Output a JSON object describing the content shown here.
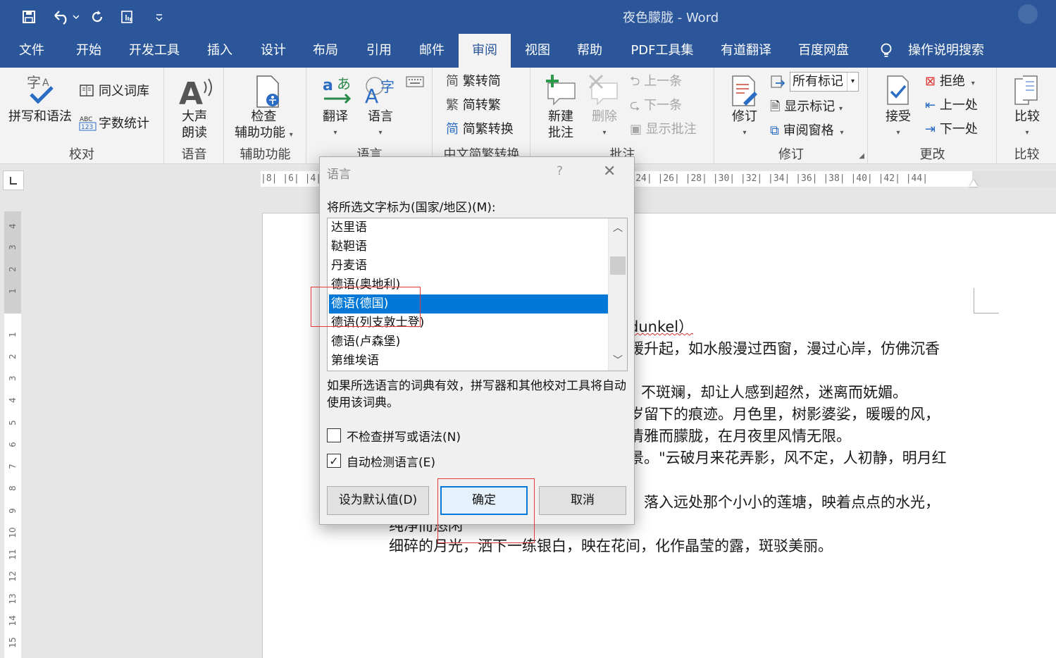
{
  "window": {
    "title": "夜色朦胧  -  Word"
  },
  "qat": {
    "save_icon": "save-icon",
    "undo_icon": "undo-icon",
    "redo_icon": "redo-icon",
    "touch_icon": "touch-mode-icon",
    "more_icon": "chevron-down-icon"
  },
  "tabs": [
    "文件",
    "开始",
    "开发工具",
    "插入",
    "设计",
    "布局",
    "引用",
    "邮件",
    "审阅",
    "视图",
    "帮助",
    "PDF工具集",
    "有道翻译",
    "百度网盘",
    "操作说明搜索"
  ],
  "active_tab": "审阅",
  "ribbon": {
    "proofing": {
      "label": "校对",
      "spelling": "拼写和语法",
      "thesaurus": "同义词库",
      "wordcount": "字数统计"
    },
    "speech": {
      "label": "语音",
      "read_aloud_1": "大声",
      "read_aloud_2": "朗读"
    },
    "accessibility": {
      "label": "辅助功能",
      "check_1": "检查",
      "check_2": "辅助功能"
    },
    "language": {
      "label": "语言",
      "translate": "翻译",
      "language": "语言"
    },
    "chinese": {
      "label": "中文简繁转换",
      "to_simplified": "繁转简",
      "to_traditional": "简转繁",
      "convert": "简繁转换"
    },
    "comments": {
      "label": "批注",
      "new_1": "新建",
      "new_2": "批注",
      "delete": "删除",
      "prev": "上一条",
      "next": "下一条",
      "show": "显示批注"
    },
    "tracking": {
      "label": "修订",
      "track": "修订",
      "markup_value": "所有标记",
      "show_markup": "显示标记",
      "review_pane": "审阅窗格"
    },
    "changes": {
      "label": "更改",
      "accept": "接受",
      "reject": "拒绝",
      "previous": "上一处",
      "next": "下一处"
    },
    "compare": {
      "label": "比较",
      "compare": "比较"
    }
  },
  "ruler": {
    "h_ticks": "|8|  |6|  |4|  |2|       |2|  |4|  |6|  |8|  |10|  |12|  |14|  |16|  |18|  |20|  |22|  |24|  |26|  |28|  |30|  |32|  |34|  |36|  |38|  |40|  |42|  |44|",
    "v_numbers": [
      "4",
      "3",
      "2",
      "1",
      "1",
      "2",
      "3",
      "4",
      "5",
      "6",
      "7",
      "8",
      "9",
      "10",
      "11",
      "12",
      "13",
      "14",
      "15"
    ]
  },
  "document": {
    "lines": [
      "dunkel）",
      "缓升起，如水般漫过西窗，漫过心岸，仿佛沉香",
      "不斑斓，却让人感到超然，迷离而妩媚。",
      "岁留下的痕迹。月色里，树影婆娑，暖暖的风，",
      "清雅而朦胧，在月夜里风情无限。",
      "景。\"云破月来花弄影，风不定，人初静，明月红",
      "，落入远处那个小小的莲塘，映着点点的水光，",
      "纯净而悠闲",
      "细碎的月光，洒下一练银白，映在花间，化作晶莹的露，斑驳美丽。"
    ]
  },
  "dialog": {
    "title": "语言",
    "help": "?",
    "close": "✕",
    "label": "将所选文字标为(国家/地区)(M):",
    "languages": [
      "达里语",
      "鞑靼语",
      "丹麦语",
      "德语(奥地利)",
      "德语(德国)",
      "德语(列支敦士登)",
      "德语(卢森堡)",
      "第维埃语"
    ],
    "selected_language": "德语(德国)",
    "info": "如果所选语言的词典有效，拼写器和其他校对工具将自动使用该词典。",
    "no_proof": {
      "label": "不检查拼写或语法(N)",
      "checked": false
    },
    "auto_detect": {
      "label": "自动检测语言(E)",
      "checked": true
    },
    "btn_default": "设为默认值(D)",
    "btn_ok": "确定",
    "btn_cancel": "取消"
  }
}
